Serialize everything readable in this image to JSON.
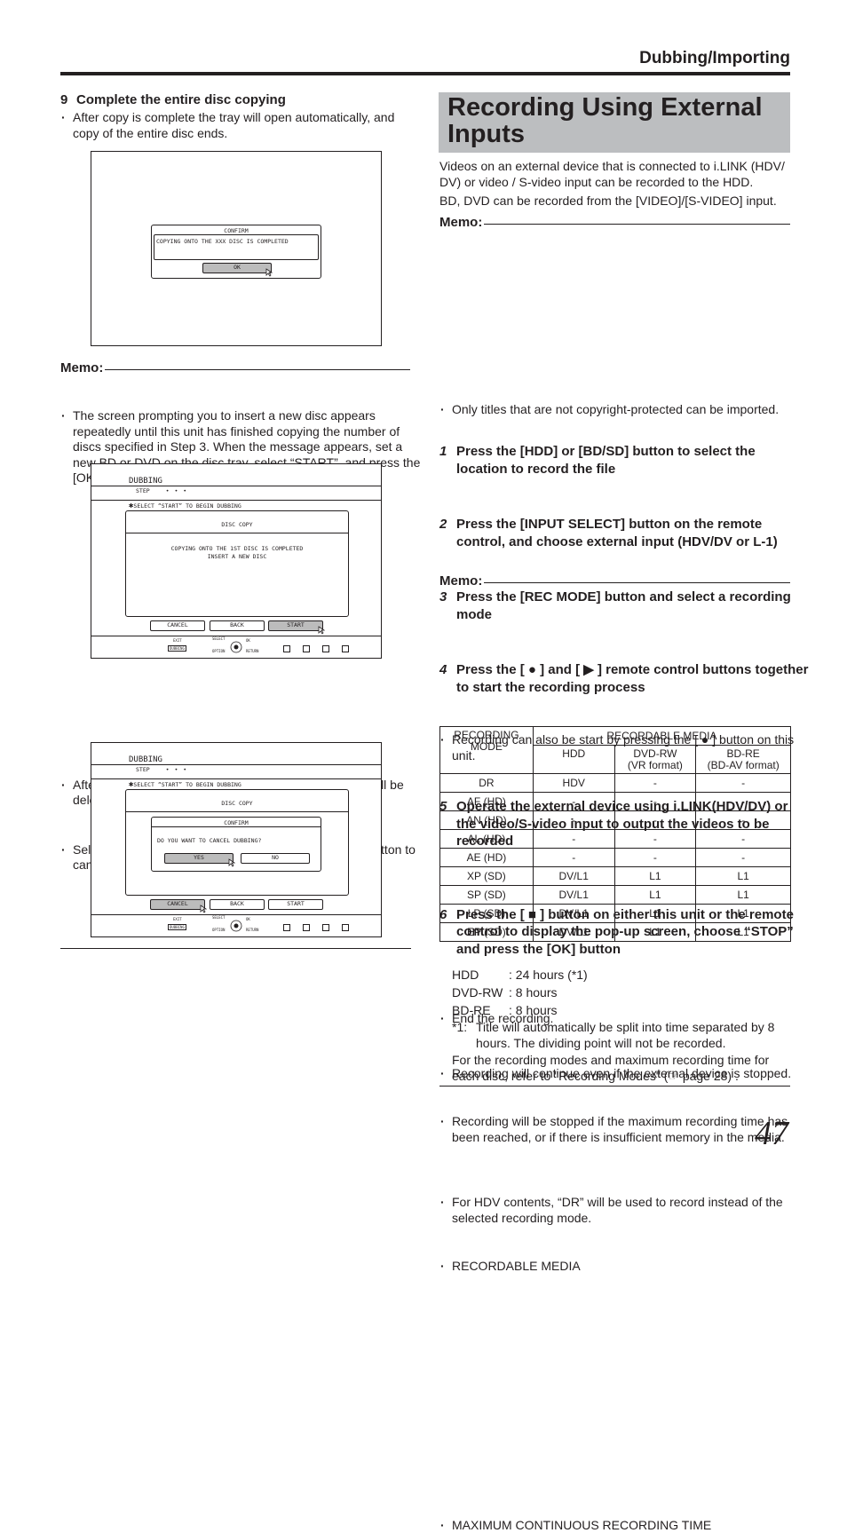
{
  "header": {
    "section_title": "Dubbing/Importing"
  },
  "left": {
    "step9": {
      "number": "9",
      "title": "Complete the entire disc copying",
      "bullet": "After copy is complete the tray will open automatically, and copy of the entire disc ends."
    },
    "screen1": {
      "dialog_title": "CONFIRM",
      "message": "COPYING ONTO THE XXX DISC IS COMPLETED",
      "ok_button": "OK"
    },
    "memo1": {
      "label": "Memo:",
      "bullet": "The screen prompting you to insert a new disc appears repeatedly until this unit has finished copying the number of discs specified in Step 3. When the message appears, set a new BD or DVD on the disc tray, select “START”, and press the [OK] button."
    },
    "screen2": {
      "title": "DUBBING",
      "step_label": "STEP",
      "step_dots": "• • •",
      "hint": "SELECT “START” TO BEGIN DUBBING",
      "panel_title": "DISC COPY",
      "message_line1": "COPYING ONTO THE 1ST DISC IS COMPLETED",
      "message_line2": "INSERT A NEW DISC",
      "buttons": [
        "CANCEL",
        "BACK",
        "START"
      ],
      "selected_button": "START",
      "footer": {
        "exit": "EXIT",
        "exit_key": "DUBBING",
        "select": "SELECT",
        "ok": "OK",
        "option": "OPTION",
        "return": "RETURN"
      }
    },
    "bullets_after": [
      "After copy is complete, the data copied onto the HDD will be deleted.",
      "Select “CANCEL” from the menu, and press the [OK] button to cancel disc copying."
    ],
    "screen3": {
      "title": "DUBBING",
      "step_label": "STEP",
      "step_dots": "• • •",
      "hint": "SELECT “START” TO BEGIN DUBBING",
      "panel_title": "DISC COPY",
      "confirm_title": "CONFIRM",
      "confirm_message": "DO YOU WANT TO CANCEL DUBBING?",
      "yes_button": "YES",
      "no_button": "NO",
      "buttons": [
        "CANCEL",
        "BACK",
        "START"
      ],
      "selected_button": "CANCEL",
      "footer": {
        "exit": "EXIT",
        "exit_key": "DUBBING",
        "select": "SELECT",
        "ok": "OK",
        "option": "OPTION",
        "return": "RETURN"
      }
    }
  },
  "right": {
    "title": "Recording Using External Inputs",
    "title_line1": "Recording Using External",
    "title_line2": "Inputs",
    "intro_line1": "Videos on an external device that is connected to i.LINK (HDV/ DV) or video / S-video input can be recorded to the HDD.",
    "intro_line2": "BD, DVD can be recorded from the [VIDEO]/[S-VIDEO] input.",
    "memo1": {
      "label": "Memo:",
      "bullet": "Only titles that are not copyright-protected can be imported."
    },
    "steps": [
      {
        "n": "1",
        "text": "Press the [HDD] or [BD/SD] button to select the location to record the file"
      },
      {
        "n": "2",
        "text": "Press the [INPUT SELECT] button on the remote control, and choose external input (HDV/DV or L-1)"
      },
      {
        "n": "3",
        "text": "Press the [REC MODE] button and select a recording mode"
      },
      {
        "n": "4",
        "text": "Press the [ ● ] and [ ▶ ] remote control buttons together to start the recording process"
      },
      {
        "n": "5",
        "text": "Operate the external device using i.LINK(HDV/DV) or the video/S-video input to output the videos to be recorded"
      },
      {
        "n": "6",
        "text": "Press the [ ■ ] button on either this unit or the remote control to display the pop-up screen, choose “STOP” and press the [OK] button"
      }
    ],
    "step4_note": "Recording can also be start by pressing the [ ● ] button on this unit.",
    "step6_note": "End the recording.",
    "memo2": {
      "label": "Memo:",
      "bullets": [
        "Recording will continue even if the external device is stopped.",
        "Recording will be stopped if the maximum recording time has been reached, or if there is insufficient memory in the media.",
        "For HDV contents, “DR” will be used to record instead of the selected recording mode.",
        "RECORDABLE MEDIA"
      ]
    },
    "table": {
      "header_mode": "RECORDING MODE",
      "header_media": "RECORDABLE MEDIA",
      "columns": [
        "HDD",
        "DVD-RW (VR format)",
        "BD-RE (BD-AV format)"
      ],
      "col_line1": [
        "HDD",
        "DVD-RW",
        "BD-RE"
      ],
      "col_line2": [
        "",
        "(VR format)",
        "(BD-AV format)"
      ],
      "rows": [
        {
          "mode": "DR",
          "hdd": "HDV",
          "dvd": "-",
          "bd": "-"
        },
        {
          "mode": "AF (HD)",
          "hdd": "-",
          "dvd": "-",
          "bd": "-"
        },
        {
          "mode": "AN (HD)",
          "hdd": "-",
          "dvd": "-",
          "bd": "-"
        },
        {
          "mode": "AL (HD)",
          "hdd": "-",
          "dvd": "-",
          "bd": "-"
        },
        {
          "mode": "AE (HD)",
          "hdd": "-",
          "dvd": "-",
          "bd": "-"
        },
        {
          "mode": "XP (SD)",
          "hdd": "DV/L1",
          "dvd": "L1",
          "bd": "L1"
        },
        {
          "mode": "SP (SD)",
          "hdd": "DV/L1",
          "dvd": "L1",
          "bd": "L1"
        },
        {
          "mode": "LP (SD)",
          "hdd": "DV/L1",
          "dvd": "L1",
          "bd": "L1"
        },
        {
          "mode": "EP (SD)",
          "hdd": "DV/L1",
          "dvd": "L1",
          "bd": "L1"
        }
      ]
    },
    "max_time": {
      "heading": "MAXIMUM CONTINUOUS RECORDING TIME",
      "items": [
        {
          "media": "HDD",
          "value": ": 24 hours (*1)"
        },
        {
          "media": "DVD-RW",
          "value": ": 8 hours"
        },
        {
          "media": "BD-RE",
          "value": ": 8 hours"
        }
      ],
      "footnote_mark": "*1:",
      "footnote": "Title will automatically be split into time separated by 8 hours. The dividing point will not be recorded.",
      "reference": "For the recording modes and maximum recording time for each disc, refer to \"Recording Modes\" (☞ page 28) ."
    }
  },
  "page_number": "47"
}
